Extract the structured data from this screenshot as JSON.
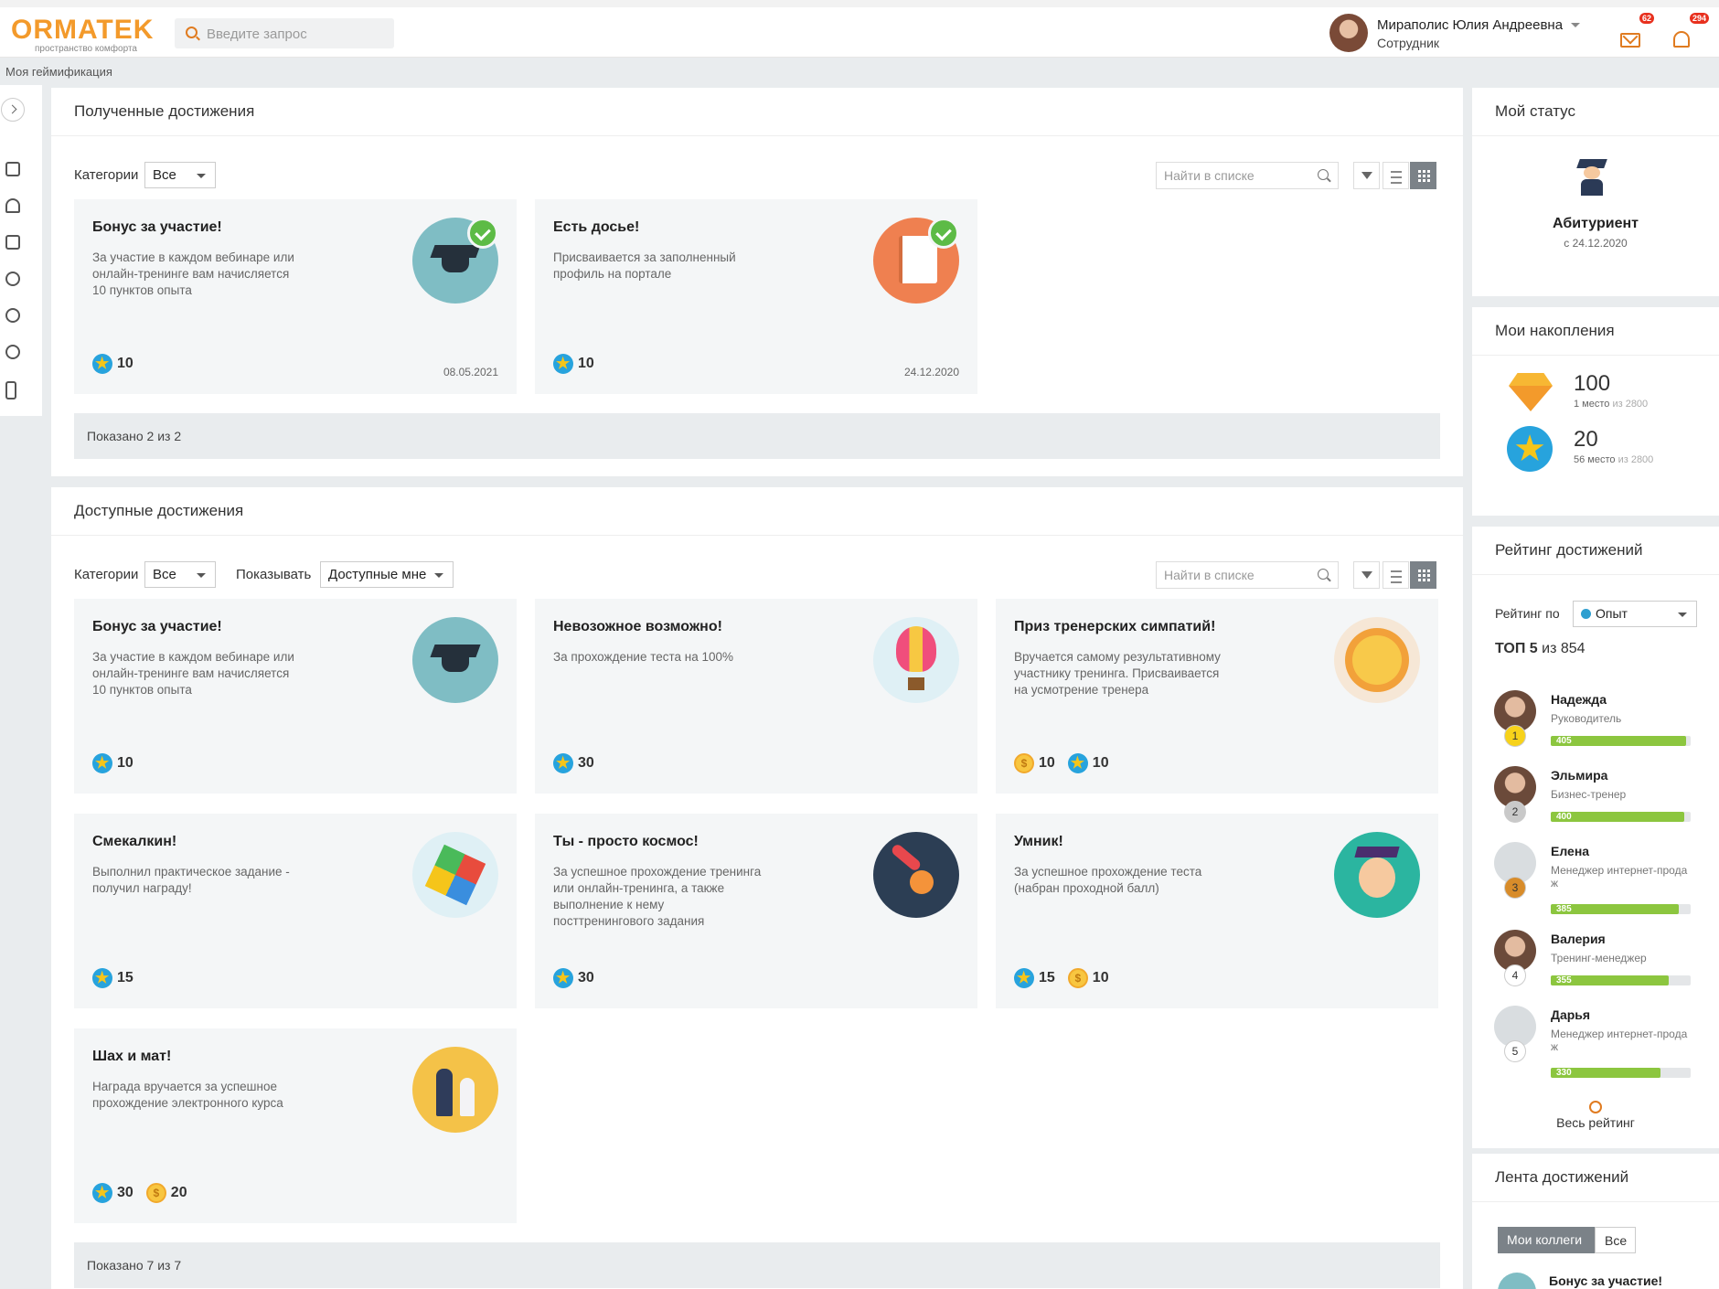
{
  "header": {
    "brand": "ORMATEK",
    "tagline": "пространство комфорта",
    "search_placeholder": "Введите запрос",
    "user_name": "Мираполис Юлия Андреевна",
    "user_role": "Сотрудник",
    "mail_count": "62",
    "bell_count": "294"
  },
  "breadcrumb": "Моя геймификация",
  "received": {
    "title": "Полученные достижения",
    "categories_label": "Категории",
    "categories_value": "Все",
    "search_placeholder": "Найти в списке",
    "footer": "Показано 2 из 2",
    "cards": [
      {
        "title": "Бонус за участие!",
        "desc": "За участие в каждом вебинаре или онлайн-тренинге вам начисляется 10 пунктов опыта",
        "stars": "10",
        "date": "08.05.2021",
        "icon": "graduation-cap-icon"
      },
      {
        "title": "Есть досье!",
        "desc": "Присваивается за заполненный профиль на портале",
        "stars": "10",
        "date": "24.12.2020",
        "icon": "notebook-icon"
      }
    ]
  },
  "available": {
    "title": "Доступные достижения",
    "categories_label": "Категории",
    "categories_value": "Все",
    "show_label": "Показывать",
    "show_value": "Доступные мне",
    "search_placeholder": "Найти в списке",
    "footer": "Показано 7 из 7",
    "cards": [
      {
        "title": "Бонус за участие!",
        "desc": "За участие в каждом вебинаре или онлайн-тренинге вам начисляется 10 пунктов опыта",
        "stars": "10",
        "icon": "graduation-cap-icon"
      },
      {
        "title": "Невозожное возможно!",
        "desc": "За прохождение теста на 100%",
        "stars": "30",
        "icon": "hot-air-balloon-icon"
      },
      {
        "title": "Приз тренерских симпатий!",
        "desc": "Вручается самому результативному участнику тренинга. Присваивается на усмотрение тренера",
        "coins": "10",
        "stars": "10",
        "icon": "sun-icon"
      },
      {
        "title": "Смекалкин!",
        "desc": "Выполнил практическое задание - получил награду!",
        "stars": "15",
        "icon": "rubiks-cube-icon"
      },
      {
        "title": "Ты - просто космос!",
        "desc": "За успешное прохождение тренинга или онлайн-тренинга, а также выполнение к нему посттренингового задания",
        "stars": "30",
        "icon": "comet-icon"
      },
      {
        "title": "Умник!",
        "desc": "За успешное прохождение теста (набран проходной балл)",
        "stars": "15",
        "coins": "10",
        "icon": "graduate-boy-icon"
      },
      {
        "title": "Шах и мат!",
        "desc": "Награда вручается за успешное прохождение электронного курса",
        "stars": "30",
        "coins": "20",
        "icon": "chess-icon"
      }
    ]
  },
  "status": {
    "title": "Мой статус",
    "level": "Абитуриент",
    "since": "с 24.12.2020"
  },
  "savings": {
    "title": "Мои накопления",
    "gems": "100",
    "gems_place": "1 место",
    "gems_of": "из 2800",
    "stars": "20",
    "stars_place": "56 место",
    "stars_of": "из 2800"
  },
  "rating": {
    "title": "Рейтинг достижений",
    "by_label": "Рейтинг по",
    "by_value": "Опыт",
    "top_label": "ТОП 5",
    "top_of": "из 854",
    "all_link": "Весь рейтинг",
    "people": [
      {
        "rank": "1",
        "name": "Надежда",
        "role": "Руководитель",
        "score": 405,
        "score_text": "405"
      },
      {
        "rank": "2",
        "name": "Эльмира",
        "role": "Бизнес-тренер",
        "score": 400,
        "score_text": "400"
      },
      {
        "rank": "3",
        "name": "Елена",
        "role": "Менеджер интернет-прода ж",
        "score": 385,
        "score_text": "385"
      },
      {
        "rank": "4",
        "name": "Валерия",
        "role": "Тренинг-менеджер",
        "score": 355,
        "score_text": "355"
      },
      {
        "rank": "5",
        "name": "Дарья",
        "role": "Менеджер интернет-прода ж",
        "score": 330,
        "score_text": "330"
      }
    ]
  },
  "feed": {
    "title": "Лента достижений",
    "tab_colleagues": "Мои коллеги",
    "tab_all": "Все",
    "first_item": "Бонус за участие!"
  },
  "colors": {
    "accent": "#f39a2b",
    "progress": "#8cc63f",
    "check": "#5dbb46"
  }
}
